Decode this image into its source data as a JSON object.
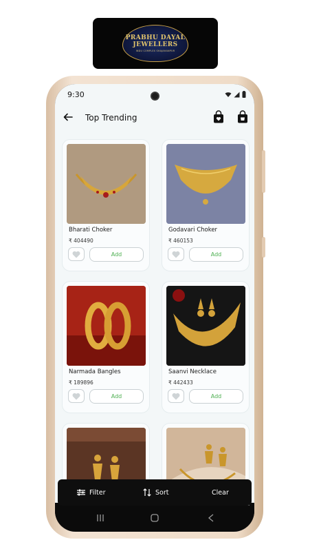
{
  "brand": {
    "line1": "PRABHU DAYAL",
    "line2": "JEWELLERS",
    "line3": "INDU COMPLEX SHAJAHANPUR"
  },
  "status_bar": {
    "time": "9:30"
  },
  "header": {
    "title": "Top Trending",
    "back_icon": "arrow-left-icon",
    "icons": [
      "wishlist-bag-icon",
      "cart-bag-icon"
    ]
  },
  "products": [
    {
      "name": "Bharati Choker",
      "price": "₹ 404490",
      "add_label": "Add",
      "image": "gold-choker-photo",
      "bg": "#b29c83"
    },
    {
      "name": "Godavari Choker",
      "price": "₹ 460153",
      "add_label": "Add",
      "image": "gold-choker-photo",
      "bg": "#7f86a6"
    },
    {
      "name": "Narmada Bangles",
      "price": "₹ 189896",
      "add_label": "Add",
      "image": "gold-bangles-photo",
      "bg": "#9a1f12"
    },
    {
      "name": "Saanvi Necklace",
      "price": "₹ 442433",
      "add_label": "Add",
      "image": "gold-necklace-photo",
      "bg": "#141414"
    },
    {
      "name": "",
      "price": "",
      "add_label": "",
      "image": "gold-earrings-photo",
      "bg": "#5a3423"
    },
    {
      "name": "",
      "price": "",
      "add_label": "",
      "image": "gold-earrings-photo",
      "bg": "#d2b79b"
    }
  ],
  "bottom_bar": {
    "filter_label": "Filter",
    "sort_label": "Sort",
    "clear_label": "Clear"
  },
  "colors": {
    "accent_green": "#4caf50",
    "app_background": "#f3f7f8",
    "bar_black": "#0e0e0e"
  }
}
